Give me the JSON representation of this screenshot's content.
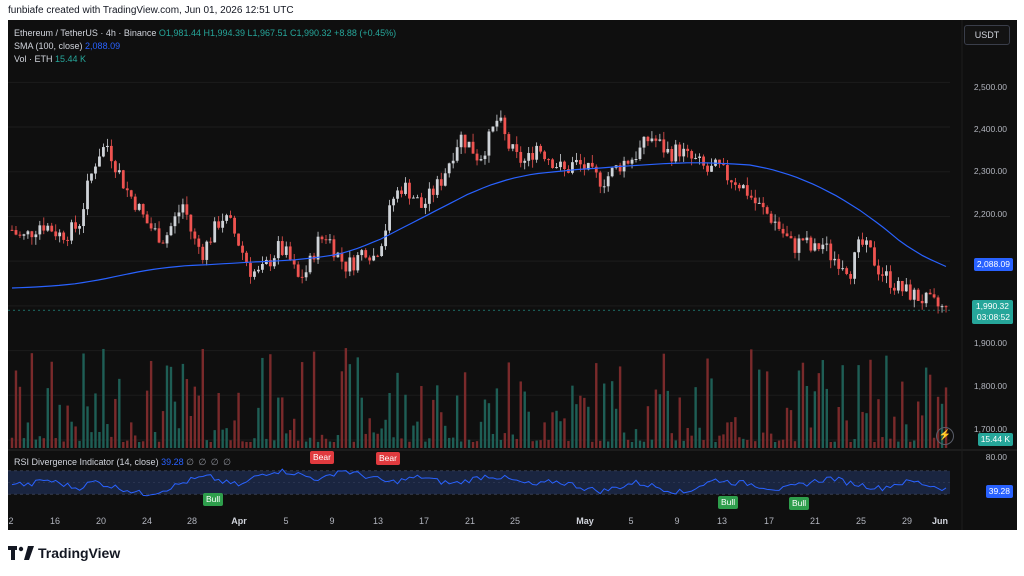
{
  "header": {
    "credit": "funbiafe created with TradingView.com, Jun 01, 2026 12:51 UTC"
  },
  "legend": {
    "symbol": "Ethereum / TetherUS · 4h · Binance",
    "ohlc": "O1,981.44  H1,994.39  L1,967.51  C1,990.32  +8.88 (+0.45%)",
    "sma_label": "SMA (100, close)",
    "sma_value": "2,088.09",
    "vol_label": "Vol · ETH",
    "vol_value": "15.44 K"
  },
  "currency_button": "USDT",
  "price_axis": {
    "labels": [
      "2,500.00",
      "2,400.00",
      "2,300.00",
      "2,200.00",
      "1,900.00",
      "1,800.00",
      "1,700.00"
    ],
    "sma_tag": "2,088.09",
    "last_price_tag": "1,990.32",
    "countdown_tag": "03:08:52",
    "volume_tag": "15.44 K"
  },
  "rsi": {
    "title": "RSI Divergence Indicator (14, close)",
    "value": "39.28",
    "dots": "∅ ∅ ∅ ∅",
    "axis_label": "80.00",
    "tag": "39.28",
    "signals": [
      {
        "kind": "bear",
        "text": "Bear"
      },
      {
        "kind": "bear",
        "text": "Bear"
      },
      {
        "kind": "bull",
        "text": "Bull"
      },
      {
        "kind": "bull",
        "text": "Bull"
      },
      {
        "kind": "bull",
        "text": "Bull"
      }
    ]
  },
  "time_axis": [
    "2",
    "16",
    "20",
    "24",
    "28",
    "Apr",
    "5",
    "9",
    "13",
    "17",
    "21",
    "25",
    "May",
    "5",
    "9",
    "13",
    "17",
    "21",
    "25",
    "29",
    "Jun"
  ],
  "footer": {
    "brand": "TradingView"
  },
  "colors": {
    "up": "#26a69a",
    "down": "#ef5350",
    "sma": "#2962ff",
    "background": "#0f0f0f",
    "bull_tag": "#2e9e4c",
    "bear_tag": "#e03a3e"
  },
  "chart_data": {
    "type": "candlestick",
    "price_min": 1700,
    "price_max": 2550,
    "close_path": [
      2170,
      2150,
      2165,
      2185,
      2175,
      2160,
      2165,
      2180,
      2270,
      2340,
      2360,
      2310,
      2260,
      2230,
      2190,
      2165,
      2150,
      2190,
      2230,
      2150,
      2120,
      2160,
      2200,
      2180,
      2130,
      2080,
      2070,
      2100,
      2130,
      2110,
      2060,
      2080,
      2140,
      2160,
      2120,
      2090,
      2100,
      2130,
      2110,
      2160,
      2240,
      2270,
      2250,
      2220,
      2250,
      2280,
      2330,
      2380,
      2360,
      2330,
      2370,
      2420,
      2360,
      2330,
      2320,
      2360,
      2340,
      2320,
      2300,
      2320,
      2310,
      2290,
      2280,
      2300,
      2320,
      2330,
      2350,
      2380,
      2360,
      2340,
      2350,
      2330,
      2320,
      2300,
      2310,
      2290,
      2280,
      2260,
      2230,
      2210,
      2190,
      2160,
      2130,
      2150,
      2120,
      2140,
      2110,
      2100,
      2080,
      2140,
      2120,
      2080,
      2060,
      2040,
      2030,
      2020,
      2010,
      2000,
      1990
    ],
    "sma_path": [
      2040,
      2042,
      2045,
      2050,
      2058,
      2068,
      2078,
      2085,
      2090,
      2092,
      2095,
      2098,
      2100,
      2103,
      2108,
      2115,
      2130,
      2150,
      2175,
      2200,
      2225,
      2250,
      2270,
      2285,
      2295,
      2300,
      2305,
      2308,
      2312,
      2315,
      2318,
      2320,
      2320,
      2318,
      2315,
      2305,
      2290,
      2270,
      2245,
      2215,
      2180,
      2140,
      2110,
      2088
    ],
    "rsi_range": [
      20,
      80
    ],
    "rsi_path": [
      50,
      45,
      55,
      48,
      40,
      52,
      44,
      38,
      30,
      35,
      45,
      55,
      60,
      50,
      45,
      62,
      70,
      68,
      60,
      55,
      72,
      65,
      58,
      50,
      55,
      60,
      52,
      48,
      55,
      62,
      58,
      50,
      45,
      52,
      48,
      40,
      35,
      42,
      50,
      45,
      38,
      32,
      45,
      55,
      50,
      48,
      42,
      38,
      45,
      52,
      58,
      50,
      45,
      40,
      48,
      52,
      45,
      39
    ]
  }
}
